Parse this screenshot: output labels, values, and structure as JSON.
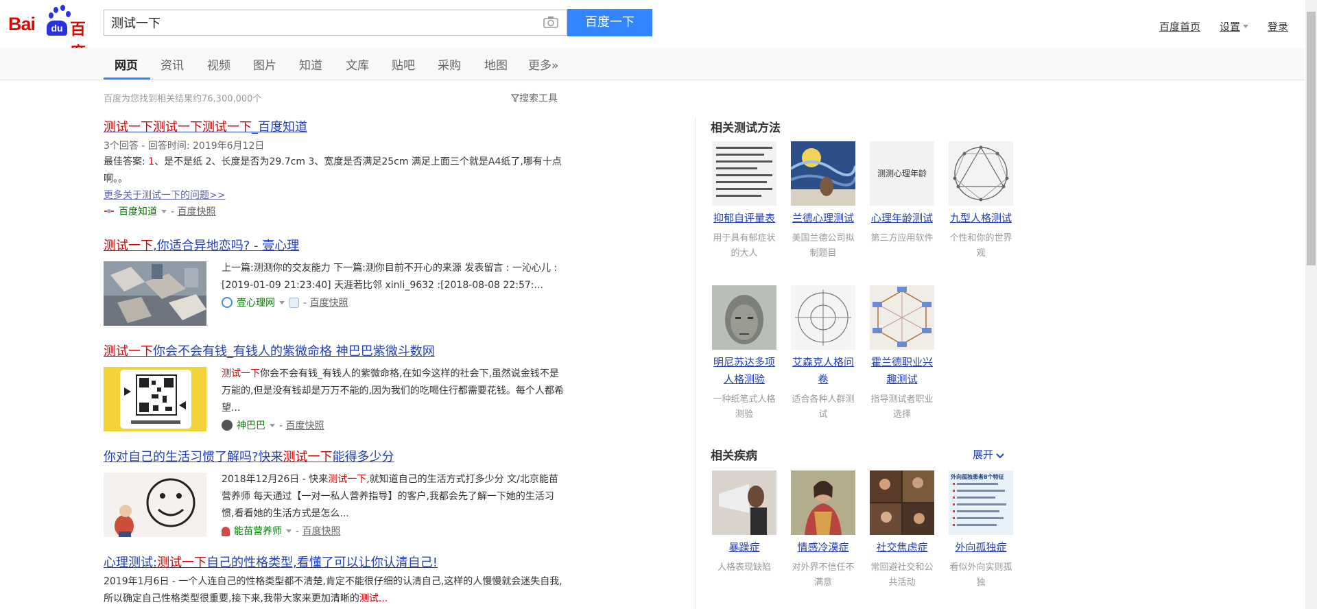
{
  "logo": {
    "bai": "Bai",
    "du": "du",
    "cn": "百度"
  },
  "search": {
    "value": "测试一下",
    "button": "百度一下"
  },
  "top_links": {
    "home": "百度首页",
    "settings": "设置",
    "login": "登录"
  },
  "tabs": [
    "网页",
    "资讯",
    "视频",
    "图片",
    "知道",
    "文库",
    "贴吧",
    "采购",
    "地图",
    "更多»"
  ],
  "result_count": "百度为您找到相关结果约76,300,000个",
  "search_tools": "搜索工具",
  "results": [
    {
      "title_red": "测试一下测试一下测试一下",
      "title_rest": "_百度知道",
      "meta": "3个回答 - 回答时间: 2019年6月12日",
      "abstract_lead": "最佳答案: ",
      "abstract_red": "1",
      "abstract": "、是不是纸 2、长度是否为29.7cm 3、宽度是否满足25cm 满足上面三个就是A4纸了,哪有十点啊。。",
      "more": "更多关于测试一下的问题>>",
      "source": "百度知道",
      "cache": "百度快照"
    },
    {
      "title_red": "测试一下",
      "title_rest": ",你适合异地恋吗? - 壹心理",
      "abstract": "上一篇:测测你的交友能力 下一篇:测你目前不开心的来源 发表留言 : 一沁心儿 :[2019-01-09 21:23:40] 天涯若比邻 xinli_9632 :[2018-08-08 22:57:...",
      "source": "壹心理网",
      "cache": "百度快照"
    },
    {
      "title_red": "测试一下",
      "title_rest": "你会不会有钱_有钱人的紫微命格 神巴巴紫微斗数网",
      "abstract_red": "测试一下",
      "abstract": "你会不会有钱_有钱人的紫微命格,在如今这样的社会下,虽然说金钱不是万能的,但是没有钱却是万万不能的,因为我们的吃喝住行都需要花钱。每个人都希望...",
      "source": "神巴巴",
      "cache": "百度快照"
    },
    {
      "title_pre": "你对自己的生活习惯了解吗?快来",
      "title_red": "测试一下",
      "title_rest": "能得多少分",
      "abstract_pre": "2018年12月26日 - 快来",
      "abstract_red": "测试一下",
      "abstract": ",就知道自己的生活方式打多少分 文/北京能苗营养师 每天通过【一对一私人营养指导】的客户,我都会先了解一下她的生活习惯,看看她的生活方式是怎么...",
      "source": "能苗营养师",
      "cache": "百度快照"
    },
    {
      "title_pre": "心理测试:",
      "title_red": "测试一下",
      "title_rest": "自己的性格类型,看懂了可以让你认清自己!",
      "abstract": "2019年1月6日 - 一个人连自己的性格类型都不清楚,肯定不能很仔细的认清自己,这样的人慢慢就会迷失自我,所以确定自己性格类型很重要,接下来,我带大家来更加清晰的",
      "abstract_red": "测试..."
    }
  ],
  "right": {
    "section1_title": "相关测试方法",
    "section1_cards": [
      {
        "name": "抑郁自评量表",
        "desc": "用于具有郁症状的大人",
        "thumb_label": ""
      },
      {
        "name": "兰德心理测试",
        "desc": "美国兰德公司拟制题目",
        "thumb_label": ""
      },
      {
        "name": "心理年龄测试",
        "desc": "第三方应用软件",
        "thumb_label": "测测心理年龄"
      },
      {
        "name": "九型人格测试",
        "desc": "个性和你的世界观",
        "thumb_label": ""
      },
      {
        "name": "明尼苏达多项人格测验",
        "desc": "一种纸笔式人格测验",
        "thumb_label": ""
      },
      {
        "name": "艾森克人格问卷",
        "desc": "适合各种人群测试",
        "thumb_label": ""
      },
      {
        "name": "霍兰德职业兴趣测试",
        "desc": "指导测试者职业选择",
        "thumb_label": ""
      }
    ],
    "section2_title": "相关疾病",
    "expand": "展开",
    "section2_cards": [
      {
        "name": "暴躁症",
        "desc": "人格表现缺陷"
      },
      {
        "name": "情感冷漠症",
        "desc": "对外界不信任不满意"
      },
      {
        "name": "社交焦虑症",
        "desc": "常回避社交和公共活动"
      },
      {
        "name": "外向孤独症",
        "desc": "看似外向实则孤独",
        "thumb_label": "外向孤独患者8个特征"
      }
    ]
  },
  "colors": {
    "accent": "#3385ff",
    "link": "#2440b3",
    "highlight": "#cc0000",
    "source": "#008000"
  }
}
